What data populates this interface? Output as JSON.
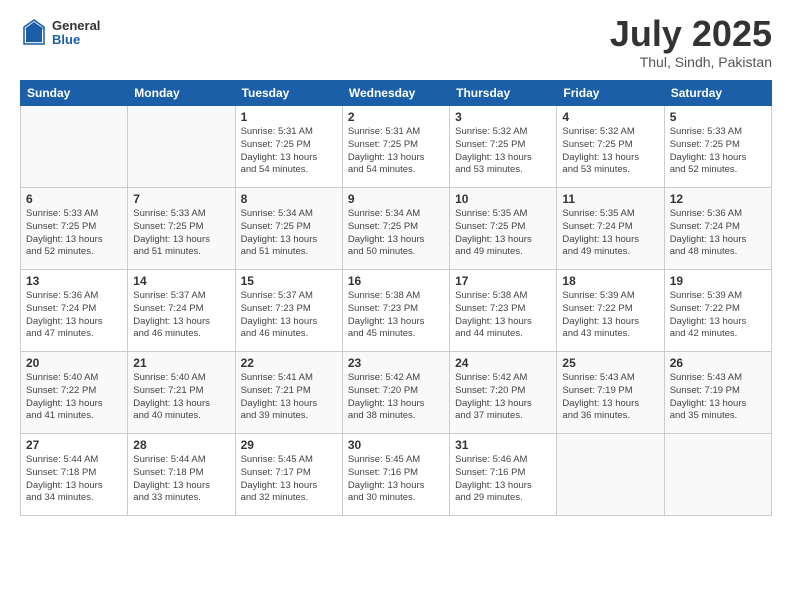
{
  "logo": {
    "general": "General",
    "blue": "Blue"
  },
  "header": {
    "month": "July 2025",
    "location": "Thul, Sindh, Pakistan"
  },
  "weekdays": [
    "Sunday",
    "Monday",
    "Tuesday",
    "Wednesday",
    "Thursday",
    "Friday",
    "Saturday"
  ],
  "weeks": [
    [
      {
        "day": "",
        "info": ""
      },
      {
        "day": "",
        "info": ""
      },
      {
        "day": "1",
        "info": "Sunrise: 5:31 AM\nSunset: 7:25 PM\nDaylight: 13 hours\nand 54 minutes."
      },
      {
        "day": "2",
        "info": "Sunrise: 5:31 AM\nSunset: 7:25 PM\nDaylight: 13 hours\nand 54 minutes."
      },
      {
        "day": "3",
        "info": "Sunrise: 5:32 AM\nSunset: 7:25 PM\nDaylight: 13 hours\nand 53 minutes."
      },
      {
        "day": "4",
        "info": "Sunrise: 5:32 AM\nSunset: 7:25 PM\nDaylight: 13 hours\nand 53 minutes."
      },
      {
        "day": "5",
        "info": "Sunrise: 5:33 AM\nSunset: 7:25 PM\nDaylight: 13 hours\nand 52 minutes."
      }
    ],
    [
      {
        "day": "6",
        "info": "Sunrise: 5:33 AM\nSunset: 7:25 PM\nDaylight: 13 hours\nand 52 minutes."
      },
      {
        "day": "7",
        "info": "Sunrise: 5:33 AM\nSunset: 7:25 PM\nDaylight: 13 hours\nand 51 minutes."
      },
      {
        "day": "8",
        "info": "Sunrise: 5:34 AM\nSunset: 7:25 PM\nDaylight: 13 hours\nand 51 minutes."
      },
      {
        "day": "9",
        "info": "Sunrise: 5:34 AM\nSunset: 7:25 PM\nDaylight: 13 hours\nand 50 minutes."
      },
      {
        "day": "10",
        "info": "Sunrise: 5:35 AM\nSunset: 7:25 PM\nDaylight: 13 hours\nand 49 minutes."
      },
      {
        "day": "11",
        "info": "Sunrise: 5:35 AM\nSunset: 7:24 PM\nDaylight: 13 hours\nand 49 minutes."
      },
      {
        "day": "12",
        "info": "Sunrise: 5:36 AM\nSunset: 7:24 PM\nDaylight: 13 hours\nand 48 minutes."
      }
    ],
    [
      {
        "day": "13",
        "info": "Sunrise: 5:36 AM\nSunset: 7:24 PM\nDaylight: 13 hours\nand 47 minutes."
      },
      {
        "day": "14",
        "info": "Sunrise: 5:37 AM\nSunset: 7:24 PM\nDaylight: 13 hours\nand 46 minutes."
      },
      {
        "day": "15",
        "info": "Sunrise: 5:37 AM\nSunset: 7:23 PM\nDaylight: 13 hours\nand 46 minutes."
      },
      {
        "day": "16",
        "info": "Sunrise: 5:38 AM\nSunset: 7:23 PM\nDaylight: 13 hours\nand 45 minutes."
      },
      {
        "day": "17",
        "info": "Sunrise: 5:38 AM\nSunset: 7:23 PM\nDaylight: 13 hours\nand 44 minutes."
      },
      {
        "day": "18",
        "info": "Sunrise: 5:39 AM\nSunset: 7:22 PM\nDaylight: 13 hours\nand 43 minutes."
      },
      {
        "day": "19",
        "info": "Sunrise: 5:39 AM\nSunset: 7:22 PM\nDaylight: 13 hours\nand 42 minutes."
      }
    ],
    [
      {
        "day": "20",
        "info": "Sunrise: 5:40 AM\nSunset: 7:22 PM\nDaylight: 13 hours\nand 41 minutes."
      },
      {
        "day": "21",
        "info": "Sunrise: 5:40 AM\nSunset: 7:21 PM\nDaylight: 13 hours\nand 40 minutes."
      },
      {
        "day": "22",
        "info": "Sunrise: 5:41 AM\nSunset: 7:21 PM\nDaylight: 13 hours\nand 39 minutes."
      },
      {
        "day": "23",
        "info": "Sunrise: 5:42 AM\nSunset: 7:20 PM\nDaylight: 13 hours\nand 38 minutes."
      },
      {
        "day": "24",
        "info": "Sunrise: 5:42 AM\nSunset: 7:20 PM\nDaylight: 13 hours\nand 37 minutes."
      },
      {
        "day": "25",
        "info": "Sunrise: 5:43 AM\nSunset: 7:19 PM\nDaylight: 13 hours\nand 36 minutes."
      },
      {
        "day": "26",
        "info": "Sunrise: 5:43 AM\nSunset: 7:19 PM\nDaylight: 13 hours\nand 35 minutes."
      }
    ],
    [
      {
        "day": "27",
        "info": "Sunrise: 5:44 AM\nSunset: 7:18 PM\nDaylight: 13 hours\nand 34 minutes."
      },
      {
        "day": "28",
        "info": "Sunrise: 5:44 AM\nSunset: 7:18 PM\nDaylight: 13 hours\nand 33 minutes."
      },
      {
        "day": "29",
        "info": "Sunrise: 5:45 AM\nSunset: 7:17 PM\nDaylight: 13 hours\nand 32 minutes."
      },
      {
        "day": "30",
        "info": "Sunrise: 5:45 AM\nSunset: 7:16 PM\nDaylight: 13 hours\nand 30 minutes."
      },
      {
        "day": "31",
        "info": "Sunrise: 5:46 AM\nSunset: 7:16 PM\nDaylight: 13 hours\nand 29 minutes."
      },
      {
        "day": "",
        "info": ""
      },
      {
        "day": "",
        "info": ""
      }
    ]
  ]
}
